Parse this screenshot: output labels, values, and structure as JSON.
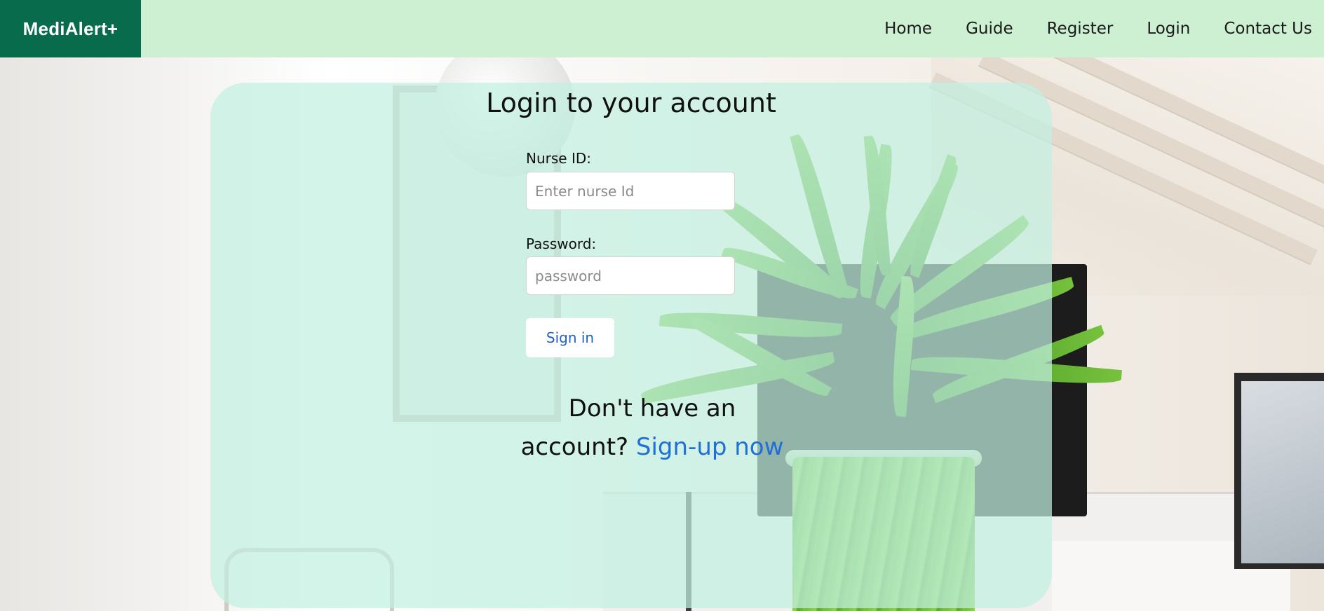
{
  "navbar": {
    "brand": "MediAlert+",
    "links": [
      "Home",
      "Guide",
      "Register",
      "Login",
      "Contact Us"
    ]
  },
  "login": {
    "title": "Login to your account",
    "nurse_id_label": "Nurse ID:",
    "nurse_id_placeholder": "Enter nurse Id",
    "nurse_id_value": "",
    "password_label": "Password:",
    "password_placeholder": "password",
    "password_value": "",
    "sign_in_label": "Sign in",
    "signup_prompt": "Don't have an account?",
    "signup_link": "Sign-up now"
  },
  "colors": {
    "brand_bg": "#076b4c",
    "navbar_bg": "#cdf0d3",
    "card_bg": "#c2f0e0",
    "link": "#1f6fd6"
  }
}
